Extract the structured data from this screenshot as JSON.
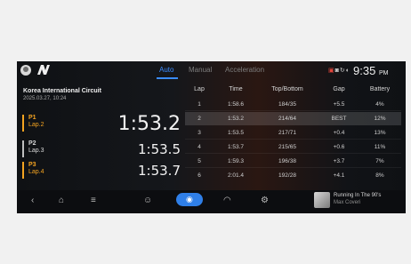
{
  "header": {
    "tabs": [
      {
        "label": "Auto",
        "active": true
      },
      {
        "label": "Manual",
        "active": false
      },
      {
        "label": "Acceleration",
        "active": false
      }
    ],
    "status_icons": [
      "record-icon",
      "camera-icon",
      "sync-icon",
      "night-mode-icon"
    ],
    "time": "9:35",
    "ampm": "PM",
    "accent_color": "#3b8cff"
  },
  "session": {
    "circuit": "Korea International Circuit",
    "datetime": "2025.03.27, 10:24"
  },
  "positions": [
    {
      "pos": "P1",
      "lap": "Lap.2",
      "time": "1:53.2",
      "color": "#f3a321"
    },
    {
      "pos": "P2",
      "lap": "Lap.3",
      "time": "1:53.5",
      "color": "#bfbfbf"
    },
    {
      "pos": "P3",
      "lap": "Lap.4",
      "time": "1:53.7",
      "color": "#f3a321"
    }
  ],
  "laps_table": {
    "columns": [
      "Lap",
      "Time",
      "Top/Bottom",
      "Gap",
      "Battery"
    ],
    "rows": [
      [
        "1",
        "1:58.6",
        "184/35",
        "+5.5",
        "4%"
      ],
      [
        "2",
        "1:53.2",
        "214/64",
        "BEST",
        "12%"
      ],
      [
        "3",
        "1:53.5",
        "217/71",
        "+0.4",
        "13%"
      ],
      [
        "4",
        "1:53.7",
        "215/65",
        "+0.6",
        "11%"
      ],
      [
        "5",
        "1:59.3",
        "196/38",
        "+3.7",
        "7%"
      ],
      [
        "6",
        "2:01.4",
        "192/28",
        "+4.1",
        "8%"
      ]
    ],
    "best_row_index": 1
  },
  "navbar": {
    "items": [
      "back-icon",
      "home-icon",
      "menu-icon",
      "driver-icon",
      "track-icon",
      "gauge-icon",
      "settings-icon"
    ],
    "active": "track-icon"
  },
  "media": {
    "title": "Running In The 90's",
    "artist": "Max Coveri"
  }
}
